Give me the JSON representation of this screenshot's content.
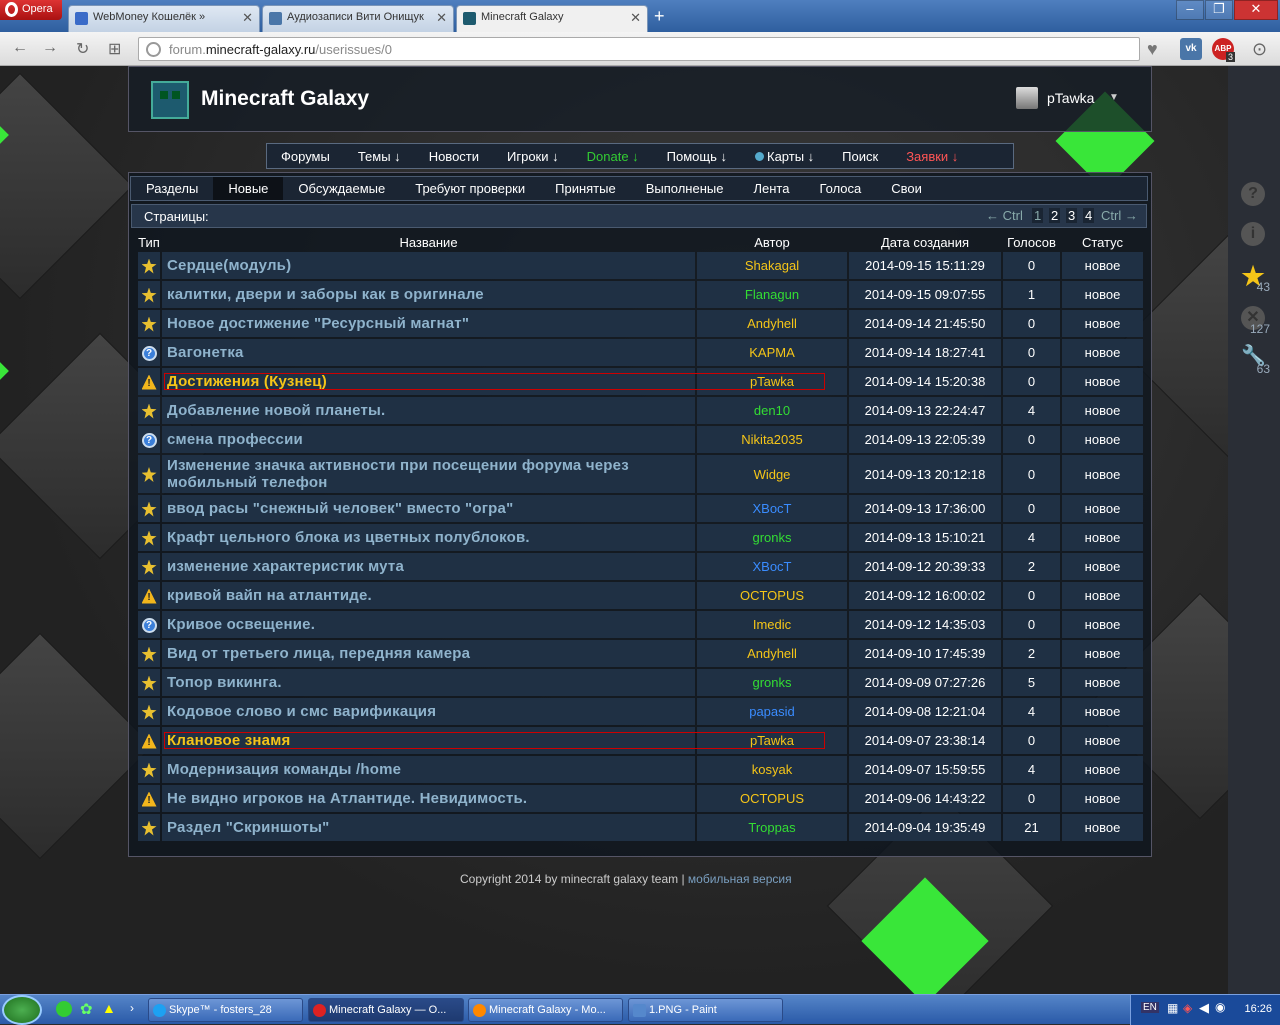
{
  "browser": {
    "menu_label": "Opera",
    "tabs": [
      {
        "title": "WebMoney Кошелёк »",
        "fav_color": "#3a6bc8"
      },
      {
        "title": "Аудиозаписи Вити Онищук",
        "fav_color": "#4a76a8"
      },
      {
        "title": "Minecraft Galaxy",
        "fav_color": "#1d5a6e"
      }
    ],
    "url_prefix": "forum.",
    "url_domain": "minecraft-galaxy.ru",
    "url_path": "/userissues/0",
    "ext_vk": "vk",
    "ext_abp": "ABP",
    "ext_abp_count": "3"
  },
  "site": {
    "title": "Minecraft Galaxy",
    "username": "pTawka",
    "user_arrow": "▼"
  },
  "main_nav": [
    {
      "label": "Форумы",
      "color": "#ffffff"
    },
    {
      "label": "Темы ↓",
      "color": "#ffffff"
    },
    {
      "label": "Новости",
      "color": "#ffffff"
    },
    {
      "label": "Игроки ↓",
      "color": "#ffffff"
    },
    {
      "label": "Donate ↓",
      "color": "#33cc33"
    },
    {
      "label": "Помощь ↓",
      "color": "#ffffff"
    },
    {
      "label": "Карты ↓",
      "color": "#ffffff"
    },
    {
      "label": "Поиск",
      "color": "#ffffff"
    },
    {
      "label": "Заявки ↓",
      "color": "#ff5555"
    }
  ],
  "sub_nav": [
    "Разделы",
    "Новые",
    "Обсуждаемые",
    "Требуют проверки",
    "Принятые",
    "Выполненые",
    "Лента",
    "Голоса",
    "Свои"
  ],
  "sub_nav_active": 1,
  "pagination": {
    "label": "Страницы:",
    "prev": "← Ctrl",
    "pages": [
      "1",
      "2",
      "3",
      "4"
    ],
    "next": "Ctrl →"
  },
  "table": {
    "headers": [
      "Тип",
      "Название",
      "Автор",
      "Дата создания",
      "Голосов",
      "Статус"
    ],
    "rows": [
      {
        "icon": "star",
        "title": "Сердце(модуль)",
        "author": "Shakagal",
        "author_color": "#f5c518",
        "date": "2014-09-15 15:11:29",
        "votes": "0",
        "status": "новое"
      },
      {
        "icon": "star",
        "title": "калитки, двери и заборы как в оригинале",
        "author": "Flanagun",
        "author_color": "#33dd33",
        "date": "2014-09-15 09:07:55",
        "votes": "1",
        "status": "новое"
      },
      {
        "icon": "starplus",
        "title": "Новое достижение \"Ресурсный магнат\"",
        "author": "Andyhell",
        "author_color": "#f5c518",
        "date": "2014-09-14 21:45:50",
        "votes": "0",
        "status": "новое"
      },
      {
        "icon": "question",
        "title": "Вагонетка",
        "author": "KAPMA",
        "author_color": "#f5c518",
        "date": "2014-09-14 18:27:41",
        "votes": "0",
        "status": "новое"
      },
      {
        "icon": "warning",
        "title": "Достижения (Кузнец)",
        "author": "pTawka",
        "author_color": "#f5c518",
        "date": "2014-09-14 15:20:38",
        "votes": "0",
        "status": "новое",
        "highlight": true
      },
      {
        "icon": "star",
        "title": "Добавление новой планеты.",
        "author": "den10",
        "author_color": "#33dd33",
        "date": "2014-09-13 22:24:47",
        "votes": "4",
        "status": "новое"
      },
      {
        "icon": "question",
        "title": "смена профессии",
        "author": "Nikita2035",
        "author_color": "#f5c518",
        "date": "2014-09-13 22:05:39",
        "votes": "0",
        "status": "новое"
      },
      {
        "icon": "starplus",
        "title": "Изменение значка активности при посещении форума через мобильный телефон",
        "author": "Widge",
        "author_color": "#f5c518",
        "date": "2014-09-13 20:12:18",
        "votes": "0",
        "status": "новое",
        "tall": true
      },
      {
        "icon": "star",
        "title": "ввод расы \"снежный человек\" вместо \"огра\"",
        "author": "XBocT",
        "author_color": "#3a8cff",
        "date": "2014-09-13 17:36:00",
        "votes": "0",
        "status": "новое"
      },
      {
        "icon": "star",
        "title": "Крафт цельного блока из цветных полублоков.",
        "author": "gronks",
        "author_color": "#33dd33",
        "date": "2014-09-13 15:10:21",
        "votes": "4",
        "status": "новое"
      },
      {
        "icon": "star",
        "title": "изменение характеристик мута",
        "author": "XBocT",
        "author_color": "#3a8cff",
        "date": "2014-09-12 20:39:33",
        "votes": "2",
        "status": "новое"
      },
      {
        "icon": "warning",
        "title": "кривой вайп на атлантиде.",
        "author": "OCTOPUS",
        "author_color": "#f5c518",
        "date": "2014-09-12 16:00:02",
        "votes": "0",
        "status": "новое"
      },
      {
        "icon": "question",
        "title": "Кривое освещение.",
        "author": "Imedic",
        "author_color": "#f5c518",
        "date": "2014-09-12 14:35:03",
        "votes": "0",
        "status": "новое"
      },
      {
        "icon": "starplus",
        "title": "Вид от третьего лица, передняя камера",
        "author": "Andyhell",
        "author_color": "#f5c518",
        "date": "2014-09-10 17:45:39",
        "votes": "2",
        "status": "новое"
      },
      {
        "icon": "starplus",
        "title": "Топор викинга.",
        "author": "gronks",
        "author_color": "#33dd33",
        "date": "2014-09-09 07:27:26",
        "votes": "5",
        "status": "новое"
      },
      {
        "icon": "starplus",
        "title": "Кодовое слово и смс варификация",
        "author": "papasid",
        "author_color": "#3a8cff",
        "date": "2014-09-08 12:21:04",
        "votes": "4",
        "status": "новое"
      },
      {
        "icon": "warning",
        "title": "Клановое знамя",
        "author": "pTawka",
        "author_color": "#f5c518",
        "date": "2014-09-07 23:38:14",
        "votes": "0",
        "status": "новое",
        "highlight": true
      },
      {
        "icon": "starplus",
        "title": "Модернизация команды /home",
        "author": "kosyak",
        "author_color": "#f5c518",
        "date": "2014-09-07 15:59:55",
        "votes": "4",
        "status": "новое"
      },
      {
        "icon": "warning",
        "title": "Не видно игроков на Атлантиде. Невидимость.",
        "author": "OCTOPUS",
        "author_color": "#f5c518",
        "date": "2014-09-06 14:43:22",
        "votes": "0",
        "status": "новое"
      },
      {
        "icon": "star",
        "title": "Раздел \"Скриншоты\"",
        "author": "Troppas",
        "author_color": "#33dd33",
        "date": "2014-09-04 19:35:49",
        "votes": "21",
        "status": "новое"
      }
    ]
  },
  "footer": {
    "copyright": "Copyright 2014 by minecraft galaxy team",
    "sep": "|",
    "mobile_link": "мобильная версия"
  },
  "sidebar": {
    "star_count": "43",
    "x_count": "127",
    "tool_count": "63"
  },
  "taskbar": {
    "items": [
      {
        "label": "Skype™ - fosters_28",
        "icon_color": "#1da1f2"
      },
      {
        "label": "Minecraft Galaxy — O...",
        "icon_color": "#d22"
      },
      {
        "label": "Minecraft Galaxy - Mo...",
        "icon_color": "#f80"
      },
      {
        "label": "1.PNG - Paint",
        "icon_color": "#58c"
      }
    ],
    "lang": "EN",
    "clock": "16:26"
  }
}
